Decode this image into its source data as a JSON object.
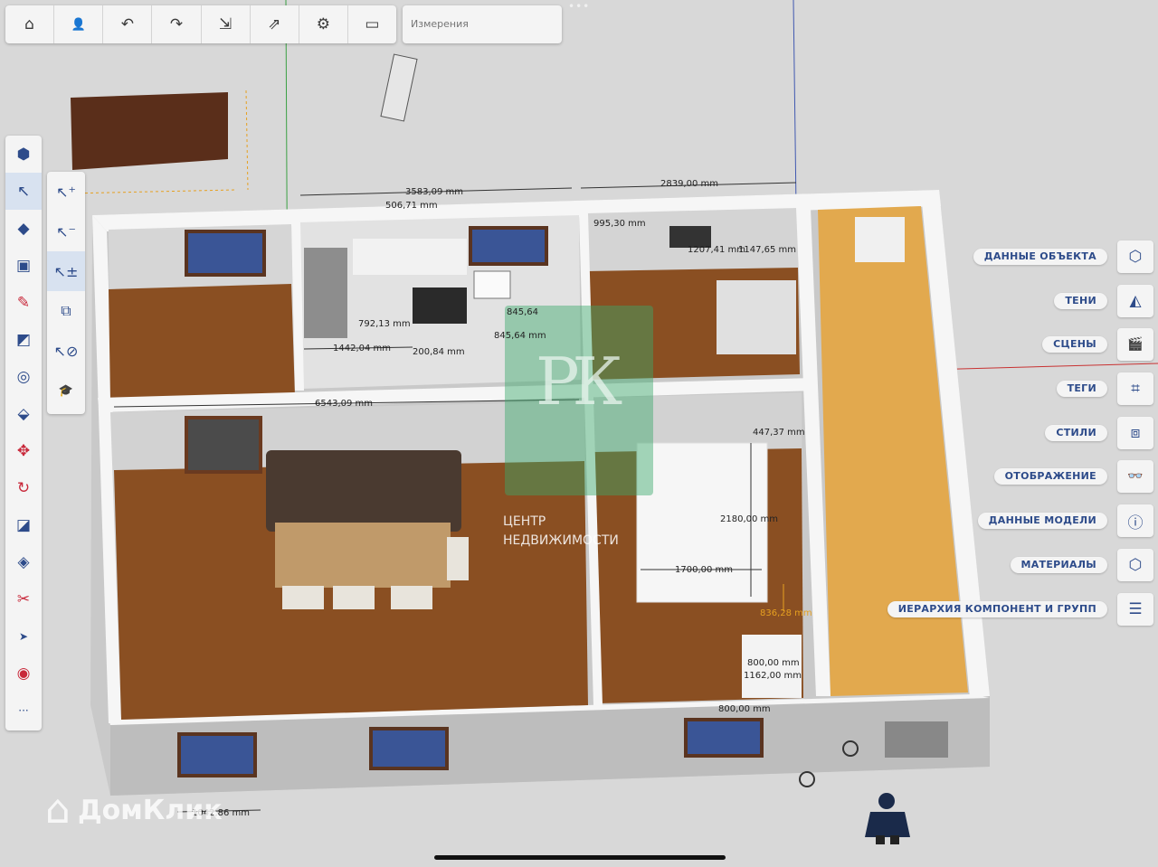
{
  "toolbar": {
    "buttons": [
      {
        "name": "home-button",
        "icon": "home-icon",
        "glyph": "⌂"
      },
      {
        "name": "account-button",
        "icon": "user-icon",
        "glyph": "👤"
      },
      {
        "name": "undo-button",
        "icon": "undo-icon",
        "glyph": "↶"
      },
      {
        "name": "redo-button",
        "icon": "redo-icon",
        "glyph": "↷"
      },
      {
        "name": "import-button",
        "icon": "import-icon",
        "glyph": "⇲"
      },
      {
        "name": "export-button",
        "icon": "export-icon",
        "glyph": "⇗"
      },
      {
        "name": "settings-button",
        "icon": "gear-icon",
        "glyph": "⚙"
      },
      {
        "name": "view-button",
        "icon": "laptop-icon",
        "glyph": "▭"
      }
    ],
    "measurements_placeholder": "Измерения",
    "overflow": "•••"
  },
  "left_tools": [
    {
      "name": "object-info-tool",
      "icon": "hexagon-icon",
      "glyph": "⬢"
    },
    {
      "name": "select-tool",
      "icon": "cursor-icon",
      "glyph": "↖",
      "active": true
    },
    {
      "name": "eraser-tool",
      "icon": "eraser-icon",
      "glyph": "◆"
    },
    {
      "name": "box-tool",
      "icon": "cube-icon",
      "glyph": "▣"
    },
    {
      "name": "pencil-tool",
      "icon": "pencil-icon",
      "glyph": "✎",
      "red": true
    },
    {
      "name": "rectangle-tool",
      "icon": "rectangle-icon",
      "glyph": "◩"
    },
    {
      "name": "circle-tool",
      "icon": "circle-icon",
      "glyph": "◎"
    },
    {
      "name": "push-pull-tool",
      "icon": "push-pull-icon",
      "glyph": "⬙"
    },
    {
      "name": "move-tool",
      "icon": "move-icon",
      "glyph": "✥",
      "red": true
    },
    {
      "name": "rotate-tool",
      "icon": "rotate-icon",
      "glyph": "↻",
      "red": true
    },
    {
      "name": "scale-tool",
      "icon": "scale-icon",
      "glyph": "◪"
    },
    {
      "name": "paint-tool",
      "icon": "paint-bucket-icon",
      "glyph": "◈"
    },
    {
      "name": "tape-measure-tool",
      "icon": "tape-measure-icon",
      "glyph": "✂"
    },
    {
      "name": "orbit-tool",
      "icon": "cursor-small-icon",
      "glyph": "➤"
    },
    {
      "name": "section-tool",
      "icon": "target-icon",
      "glyph": "◉",
      "red": true
    },
    {
      "name": "more-tools",
      "icon": "ellipsis-icon",
      "glyph": "···"
    }
  ],
  "sub_tools": [
    {
      "name": "select-add-tool",
      "icon": "select-add-icon",
      "glyph": "↖⁺"
    },
    {
      "name": "select-subtract-tool",
      "icon": "select-minus-icon",
      "glyph": "↖⁻"
    },
    {
      "name": "select-toggle-tool",
      "icon": "select-toggle-icon",
      "glyph": "↖±",
      "active": true
    },
    {
      "name": "select-all-tool",
      "icon": "select-cubes-icon",
      "glyph": "⧉"
    },
    {
      "name": "select-none-tool",
      "icon": "select-none-icon",
      "glyph": "↖⊘"
    },
    {
      "name": "learn-tool",
      "icon": "graduation-cap-icon",
      "glyph": "🎓"
    }
  ],
  "right_panel": [
    {
      "label": "ДАННЫЕ ОБЪЕКТА",
      "icon": "hexagon-outline-icon",
      "glyph": "⬡"
    },
    {
      "label": "ТЕНИ",
      "icon": "shadow-icon",
      "glyph": "◭"
    },
    {
      "label": "СЦЕНЫ",
      "icon": "clapperboard-icon",
      "glyph": "🎬"
    },
    {
      "label": "ТЕГИ",
      "icon": "tag-icon",
      "glyph": "⌗"
    },
    {
      "label": "СТИЛИ",
      "icon": "cubes-icon",
      "glyph": "⧈"
    },
    {
      "label": "ОТОБРАЖЕНИЕ",
      "icon": "glasses-icon",
      "glyph": "👓"
    },
    {
      "label": "ДАННЫЕ МОДЕЛИ",
      "icon": "info-icon",
      "glyph": "ⓘ"
    },
    {
      "label": "МАТЕРИАЛЫ",
      "icon": "material-cube-icon",
      "glyph": "⬡"
    },
    {
      "label": "ИЕРАРХИЯ КОМПОНЕНТ И ГРУПП",
      "icon": "hierarchy-icon",
      "glyph": "☰"
    }
  ],
  "dimensions": {
    "d1": "3583,09 mm",
    "d2": "2839,00 mm",
    "d3": "995,30 mm",
    "d4": "1207,41 mm",
    "d5": "1147,65 mm",
    "d6": "792,13 mm",
    "d7": "1442,04 mm",
    "d8": "200,84 mm",
    "d9": "845,64",
    "d10": "845,64 mm",
    "d11": "6543,09 mm",
    "d12": "447,37 mm",
    "d13": "2180,00 mm",
    "d14": "1700,00 mm",
    "d15": "836,28 mm",
    "d16": "800,00 mm",
    "d17": "1162,00 mm",
    "d18": "800,00 mm",
    "d19": "1042,86 mm",
    "d20": "506,71 mm"
  },
  "watermark": {
    "logo": "РК",
    "line1": "ЦЕНТР",
    "line2": "НЕДВИЖИМОСТИ",
    "domclick": "ДомКлик"
  },
  "colors": {
    "accent": "#2d4b8a",
    "toolbar_bg": "#f4f4f4",
    "floor_wood": "#8a4f22",
    "balcony": "#e2a94e",
    "wall": "#f5f5f5"
  }
}
